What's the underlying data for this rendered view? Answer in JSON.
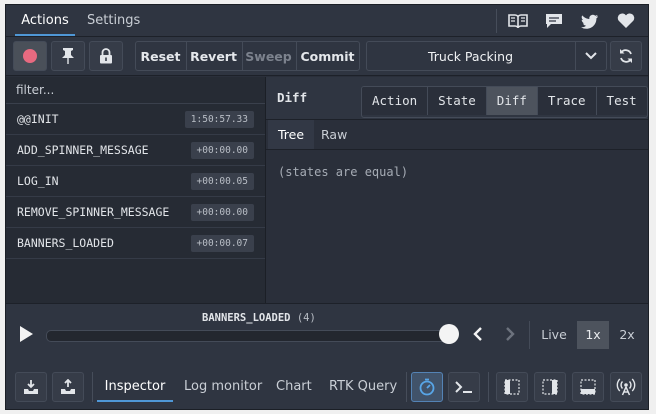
{
  "top_tabs": {
    "actions": "Actions",
    "settings": "Settings"
  },
  "top_icons": [
    "docs-book-icon",
    "chat-bubble-icon",
    "twitter-bird-icon",
    "heart-icon"
  ],
  "toolbar": {
    "reset": "Reset",
    "revert": "Revert",
    "sweep": "Sweep",
    "commit": "Commit",
    "instance_selected": "Truck Packing"
  },
  "filter": {
    "placeholder": "filter..."
  },
  "actions": [
    {
      "name": "@@INIT",
      "time": "1:50:57.33"
    },
    {
      "name": "ADD_SPINNER_MESSAGE",
      "time": "+00:00.00"
    },
    {
      "name": "LOG_IN",
      "time": "+00:00.05"
    },
    {
      "name": "REMOVE_SPINNER_MESSAGE",
      "time": "+00:00.00"
    },
    {
      "name": "BANNERS_LOADED",
      "time": "+00:00.07"
    }
  ],
  "inspector": {
    "title": "Diff",
    "tabs": [
      "Action",
      "State",
      "Diff",
      "Trace",
      "Test"
    ],
    "active_tab": "Diff",
    "subtabs": [
      "Tree",
      "Raw"
    ],
    "active_subtab": "Tree",
    "message": "(states are equal)"
  },
  "slider": {
    "current_action": "BANNERS_LOADED",
    "count": "(4)",
    "position": 1.0,
    "live": "Live",
    "speed_1x": "1x",
    "speed_2x": "2x",
    "active_speed": "1x"
  },
  "monitor_tabs": {
    "inspector": "Inspector",
    "log_monitor": "Log monitor",
    "chart": "Chart",
    "rtk_query": "RTK Query",
    "active": "Inspector"
  },
  "colors": {
    "background": "#2a2f3a",
    "panel": "#2f3541",
    "accent": "#4f97d6",
    "record": "#e86a80"
  }
}
